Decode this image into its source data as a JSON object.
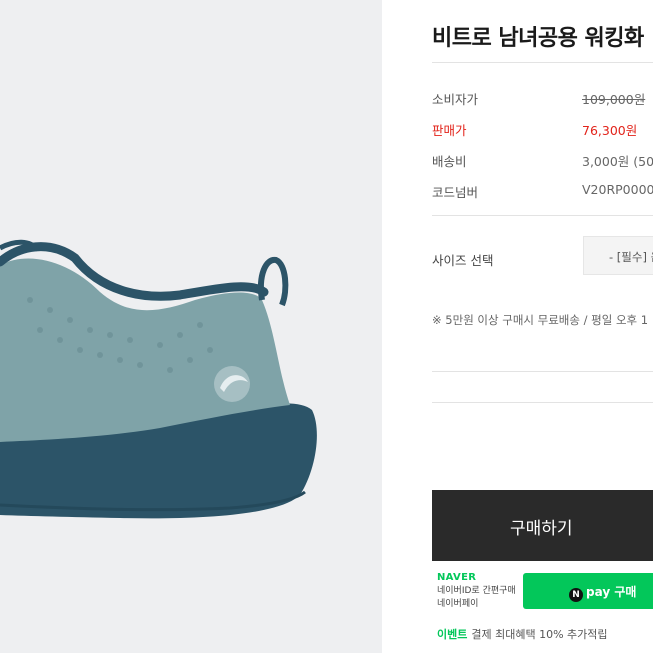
{
  "product": {
    "title": "비트로 남녀공용 워킹화",
    "image_alt_icon": "sneaker-image"
  },
  "prices": [
    {
      "label": "소비자가",
      "value": "109,000원",
      "style": "strike"
    },
    {
      "label": "판매가",
      "value": "76,300원",
      "style": "sale"
    },
    {
      "label": "배송비",
      "value": "3,000원 (50",
      "style": "normal"
    },
    {
      "label": "코드넘버",
      "value": "V20RP0000",
      "style": "normal"
    }
  ],
  "options": {
    "size_label": "사이즈 선택",
    "size_select_value": "- [필수] 옵"
  },
  "notice": "※ 5만원 이상 구매시 무료배송 / 평일 오후 1",
  "actions": {
    "buy_label": "구매하기"
  },
  "naver": {
    "logo": "NAVER",
    "desc_line1": "네이버ID로 간편구매",
    "desc_line2": "네이버페이",
    "npay_icon": "N",
    "npay_label": "pay 구매",
    "event_tag": "이벤트",
    "event_text": "결제 최대혜택 10% 추가적립"
  },
  "colors": {
    "sale": "#e2231a",
    "buy_button": "#2a2a2a",
    "naver_green": "#03c75a",
    "shoe_upper": "#7fa3a8",
    "shoe_sole": "#2c5468"
  }
}
